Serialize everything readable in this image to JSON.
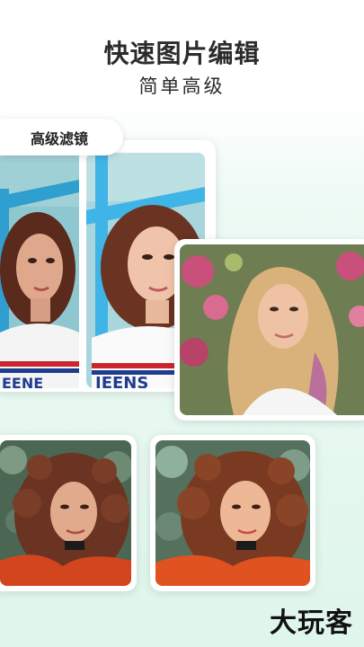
{
  "header": {
    "title": "快速图片编辑",
    "subtitle": "简单高级"
  },
  "filter_tag": {
    "label": "高级滤镜"
  },
  "gallery": {
    "photos": [
      {
        "icon": "portrait-photo-original"
      },
      {
        "icon": "portrait-photo-filtered"
      },
      {
        "icon": "blonde-portrait-photo"
      },
      {
        "icon": "curly-portrait-photo-original"
      },
      {
        "icon": "curly-portrait-photo-filtered"
      }
    ]
  },
  "brand": {
    "watermark": "大玩客"
  },
  "colors": {
    "background_top": "#ffffff",
    "background_bottom": "#dff6ec",
    "title_text": "#2b2b2b",
    "card": "#ffffff",
    "sky_blue_frame": "#3fb4e6",
    "hair_brown": "#6a3322",
    "skin": "#e8b89a",
    "blonde_hair": "#d8b27a",
    "red_jacket": "#d2451d",
    "foliage": "#3c5a46"
  }
}
